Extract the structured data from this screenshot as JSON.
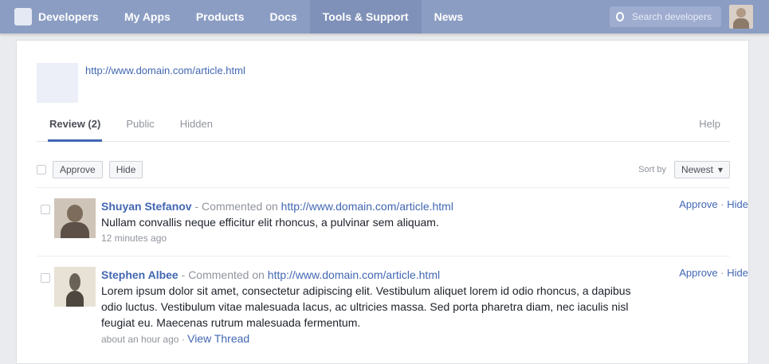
{
  "topbar": {
    "brand": "Developers",
    "nav": [
      "My Apps",
      "Products",
      "Docs",
      "Tools & Support",
      "News"
    ],
    "active_index": 3,
    "search_placeholder": "Search developers"
  },
  "page": {
    "url": "http://www.domain.com/article.html"
  },
  "tabs": {
    "items": [
      "Review (2)",
      "Public",
      "Hidden"
    ],
    "active_index": 0,
    "right_label": "Help"
  },
  "filter": {
    "approve_label": "Approve",
    "hide_label": "Hide",
    "sort_label": "Sort by",
    "sort_value": "Newest"
  },
  "comments": [
    {
      "author": "Shuyan Stefanov",
      "separator": " - ",
      "commented_on": "Commented on",
      "link": "http://www.domain.com/article.html",
      "text": "Nullam convallis neque efficitur elit rhoncus, a pulvinar sem aliquam.",
      "time": "12 minutes ago",
      "reply": "",
      "approve": "Approve",
      "hide": "Hide"
    },
    {
      "author": "Stephen Albee",
      "separator": " - ",
      "commented_on": "Commented on",
      "link": "http://www.domain.com/article.html",
      "text": "Lorem ipsum dolor sit amet, consectetur adipiscing elit. Vestibulum aliquet lorem id odio rhoncus, a dapibus odio luctus. Vestibulum vitae malesuada lacus, ac ultricies massa. Sed porta pharetra diam, nec iaculis nisl feugiat eu. Maecenas rutrum malesuada fermentum.",
      "time": "about an hour ago",
      "reply": "View Thread",
      "approve": "Approve",
      "hide": "Hide"
    }
  ],
  "colors": {
    "topbar": "#8b9dc3",
    "link": "#4267b2",
    "background": "#e9ebee"
  }
}
